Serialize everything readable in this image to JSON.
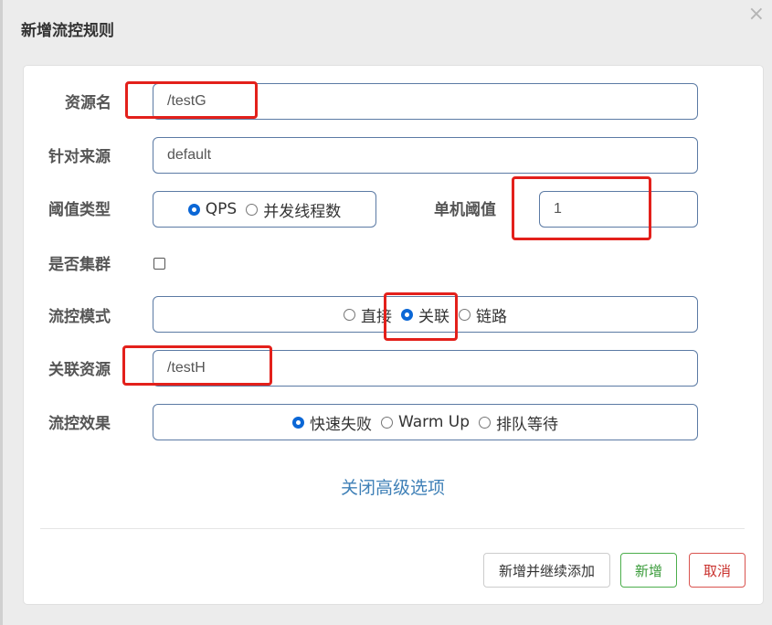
{
  "dialog": {
    "title": "新增流控规则",
    "close_symbol": "×"
  },
  "form": {
    "resource": {
      "label": "资源名",
      "value": "/testG"
    },
    "limit_app": {
      "label": "针对来源",
      "value": "default"
    },
    "grade": {
      "label": "阈值类型",
      "options": [
        "QPS",
        "并发线程数"
      ],
      "selected": "QPS"
    },
    "count": {
      "label": "单机阈值",
      "value": "1"
    },
    "cluster": {
      "label": "是否集群",
      "checked": false
    },
    "strategy": {
      "label": "流控模式",
      "options": [
        "直接",
        "关联",
        "链路"
      ],
      "selected": "关联"
    },
    "ref_resource": {
      "label": "关联资源",
      "value": "/testH"
    },
    "control_behavior": {
      "label": "流控效果",
      "options": [
        "快速失败",
        "Warm Up",
        "排队等待"
      ],
      "selected": "快速失败"
    },
    "advanced_toggle": "关闭高级选项"
  },
  "footer": {
    "add_continue_label": "新增并继续添加",
    "add_label": "新增",
    "cancel_label": "取消"
  },
  "colors": {
    "annotation_red": "#e3201b",
    "radio_blue": "#0b67d6",
    "link_blue": "#3f80b7",
    "success_green": "#4cae4c",
    "danger_red": "#d9534f"
  }
}
